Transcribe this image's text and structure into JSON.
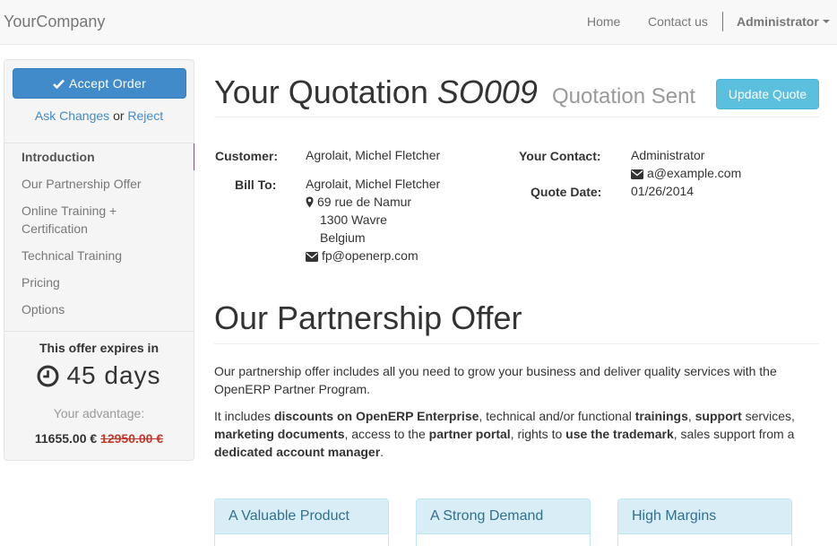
{
  "navbar": {
    "brand": "YourCompany",
    "links": [
      "Home",
      "Contact us"
    ],
    "user": "Administrator"
  },
  "sidebar": {
    "accept_label": "Accept Order",
    "ask_changes": "Ask Changes",
    "or_text": "or",
    "reject": "Reject",
    "toc": [
      "Introduction",
      "Our Partnership Offer",
      "Online Training + Certification",
      "Technical Training",
      "Pricing",
      "Options"
    ],
    "expires_title": "This offer expires in",
    "expires_days": "45 days",
    "advantage_label": "Your advantage:",
    "new_price": "11655.00 €",
    "old_price": "12950.00 €"
  },
  "header": {
    "title_prefix": "Your Quotation",
    "number": "SO009",
    "state": "Quotation Sent",
    "update_label": "Update Quote"
  },
  "details": {
    "customer_label": "Customer:",
    "customer": "Agrolait, Michel Fletcher",
    "bill_to_label": "Bill To:",
    "bill_to_name": "Agrolait, Michel Fletcher",
    "street": "69 rue de Namur",
    "city": "1300 Wavre",
    "country": "Belgium",
    "email": "fp@openerp.com",
    "contact_label": "Your Contact:",
    "contact_name": "Administrator",
    "contact_email": "a@example.com",
    "date_label": "Quote Date:",
    "date": "01/26/2014"
  },
  "section": {
    "title": "Our Partnership Offer",
    "para1": "Our partnership offer includes all you need to grow your business and deliver quality services with the OpenERP Partner Program.",
    "p2": {
      "t1": "It includes ",
      "b1": "discounts on OpenERP Enterprise",
      "t2": ", technical and/or functional ",
      "b2": "trainings",
      "t3": ", ",
      "b3": "support",
      "t4": " services, ",
      "b4": "marketing documents",
      "t5": ", access to the ",
      "b5": "partner portal",
      "t6": ", rights to ",
      "b6": "use the trademark",
      "t7": ", sales support from a ",
      "b7": "dedicated account manager",
      "t8": "."
    }
  },
  "panels": [
    "A Valuable Product",
    "A Strong Demand",
    "High Margins"
  ],
  "icons": {
    "accept": "check-icon",
    "address": "map-marker-icon",
    "email": "envelope-icon",
    "expiry": "clock-icon"
  },
  "colors": {
    "primary": "#428bca",
    "info": "#5bc0de",
    "panel_head": "#d9edf7",
    "old_price": "#c0392b"
  }
}
